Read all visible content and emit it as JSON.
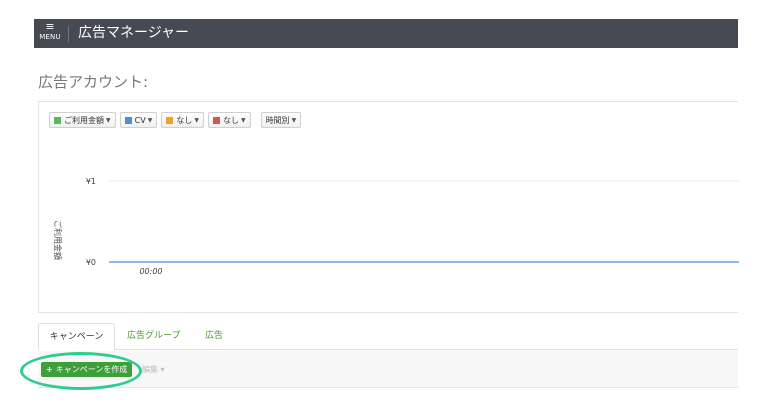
{
  "topbar": {
    "menu_glyph": "≡",
    "menu_label": "MENU",
    "app_title": "広告マネージャー"
  },
  "page": {
    "title": "広告アカウント:"
  },
  "chart_controls": {
    "metrics": [
      {
        "label": "ご利用金額",
        "color": "#5cb85c"
      },
      {
        "label": "CV",
        "color": "#4a90d9"
      },
      {
        "label": "なし",
        "color": "#f0a030"
      },
      {
        "label": "なし",
        "color": "#d9534f"
      }
    ],
    "period": "時間別"
  },
  "chart_data": {
    "type": "line",
    "ylabel": "ご利用金額",
    "yticks": [
      "¥1",
      "¥0"
    ],
    "ylim": [
      0,
      1
    ],
    "x": [
      "00:00"
    ],
    "series": [
      {
        "name": "ご利用金額",
        "color": "#4a90d9",
        "values": [
          0
        ]
      }
    ],
    "grid": true
  },
  "tabs": [
    {
      "label": "キャンペーン"
    },
    {
      "label": "広告グループ"
    },
    {
      "label": "広告"
    }
  ],
  "actions": {
    "create_label": "キャンペーンを作成",
    "create_icon": "+",
    "edit_label": "編集",
    "edit_caret": "▾",
    "highlight_color": "#2ecc8e"
  }
}
